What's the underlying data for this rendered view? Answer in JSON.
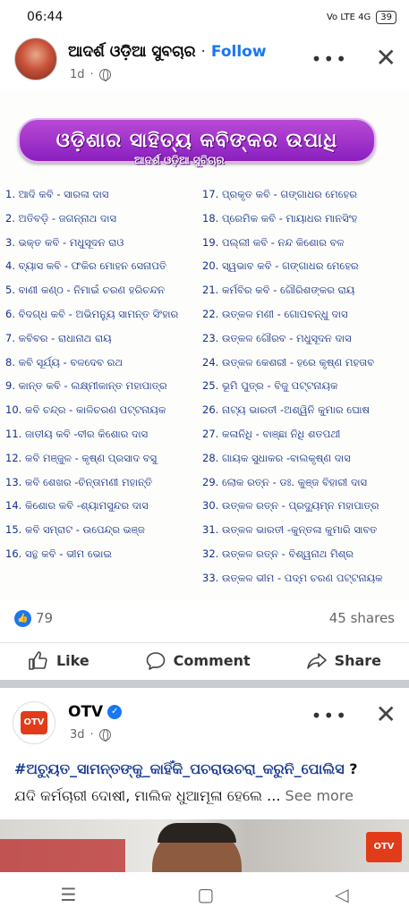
{
  "status_bar": {
    "time": "06:44",
    "network": "Vo LTE 4G",
    "battery": "39"
  },
  "post1": {
    "author": "ଆଦର୍ଶ ଓଡ଼ିଆ ସୁବଚାର",
    "separator": "·",
    "follow_label": "Follow",
    "time": "1d",
    "more_label": "•••",
    "close_label": "✕",
    "poster": {
      "title": "ଓଡ଼ିଶାର ସାହିତ୍ୟ କବିଙ୍କର ଉପାଧି",
      "subtitle": "ଆଦର୍ଶ ଓଡ଼ିଆ ସୁବିଚାର",
      "left_rows": [
        "1. ଆଦି କବି -    ସାରଳା ଦାସ",
        "2. ଅତିବଡ଼ି -    ଜଗନ୍ନାଥ ଦାସ",
        "3. ଭକ୍ତ କବି -   ମଧୁସୂଦନ ରାଓ",
        "4. ବ୍ୟାସ କବି -  ଫକିର ମୋହନ ସେନାପତି",
        "5. ବାଣୀ କଣ୍ଠ -  ନିମାଇଁ ଚରଣ ହରିଚନ୍ଦନ",
        "6. ବିଦଗ୍ଧ କବି -  ଅଭିମନ୍ୟୁ ସାମନ୍ତ ସିଂହାର",
        "7. କବିବର -     ରାଧାନାଥ ରାୟ",
        "8. କବି ସୂର୍ଯ୍ୟ -  ବଳଦେବ ରଥ",
        "9. କାନ୍ତ କବି -   ଲକ୍ଷ୍ମୀକାନ୍ତ ମହାପାତ୍ର",
        "10. କବି ଚନ୍ଦ୍ର -   କାଳିଚରଣ ପଟ୍ଟନାୟକ",
        "11. ଜାତୀୟ କବି -ବୀର କିଶୋର ଦାସ",
        "12. କବି ମଞ୍ଜୁଳ - କୃଷ୍ଣ ପ୍ରସାଦ ବସୁ",
        "13. କବି ଶେଖର -ଚିନ୍ତାମଣୀ ମହାନ୍ତି",
        "14. କିଶୋର କବି -ଶ୍ୟାମସୁନ୍ଦର ଦାସ",
        "15. କବି ସମ୍ରାଟ - ଉପେନ୍ଦ୍ର ଭଞ୍ଜ",
        "16. ସନ୍ଥ କବି -   ଭୀମ ଭୋଇ"
      ],
      "right_rows": [
        "17. ପ୍ରକୃତ କବି -   ଗଙ୍ଗାଧର ମେହେର",
        "18. ପ୍ରେମିକ କବି -  ମାୟାଧର ମାନସିଂହ",
        "19. ପଲ୍ଲୀ କବି -   ନନ୍ଦ କିଶୋର ବଳ",
        "20. ସ୍ୱଭାବ କବି -  ଗଙ୍ଗାଧର ମେହେର",
        "21. କର୍ମବିର କବି - ଗୌରିଶଙ୍କର ରାୟ",
        "22. ଉତ୍କଳ ମଣୀ -  ଗୋପବନ୍ଧୁ ଦାସ",
        "23. ଉତ୍କଳ ଗୌରବ - ମଧୁସୂଦନ ଦାସ",
        "24. ଉତ୍କଳ କେଶରୀ - ହରେ କୃଷ୍ଣ ମହତାବ",
        "25. ଭୂମି ପୁତ୍ର -   ବିଜୁ ପଟ୍ଟନାୟକ",
        "26. ନାଟ୍ୟ ଭାରତୀ -ଅଶ୍ୱିନି କୁମାର ଘୋଷ",
        "27. କଳାନିଧି -    ବାଞ୍ଛା ନିଧି ଶତପଥୀ",
        "28. ଗାୟକ ସୁଧାକର -ବାଲକୃଷ୍ଣ ଦାସ",
        "29. ଲୋକ ରତ୍ନ -  ଡଃ. କୁଞ୍ଜ ବିହାରୀ ଦାସ",
        "30. ଉତ୍କଳ ରତ୍ନ -  ପ୍ରଦ୍ୟୁମ୍ନ ମହାପାତ୍ର",
        "31. ଉତ୍କଳ ଭାରତୀ -କୁନ୍ତଳା କୁମାରି ସାବତ",
        "32. ଉତ୍କଳ ରତ୍ନ -  ବିଶ୍ୱନାଥ ମିଶ୍ର",
        "33. ଉତ୍କଳ ଭୀମ -  ପଦ୍ମ ଚରଣ ପଟ୍ଟନାୟକ"
      ]
    },
    "reactions_count": "79",
    "shares": "45 shares",
    "actions": {
      "like": "Like",
      "comment": "Comment",
      "share": "Share"
    }
  },
  "post2": {
    "author": "OTV",
    "logo_text": "OTV",
    "time": "3d",
    "more_label": "•••",
    "close_label": "✕",
    "hashtag": "#ଅଚ୍ୟୁତ_ସାମନ୍ତଙ୍କୁ_କାହିଁକି_ପଚରାଉଚରା_କରୁନି_ପୋଲିସ",
    "hashtag_end": " ?",
    "text": "ଯଦି କର୍ମଚାରୀ ଦୋଷୀ, ମାଲିକ ଧୁଆମୂଳା ହେଲେ ... ",
    "see_more": "See more",
    "photo_logo": "OTV"
  },
  "navbar": {
    "menu": "☰",
    "home": "▢",
    "back": "◁"
  },
  "colors": {
    "accent": "#1877f2",
    "poster_text": "#15328a",
    "banner": "#9b2fcd"
  }
}
